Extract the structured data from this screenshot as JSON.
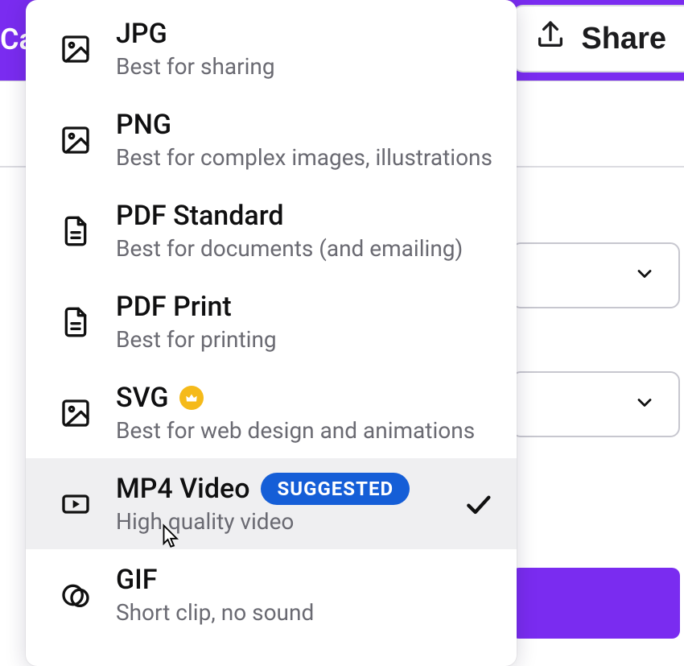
{
  "topbar": {
    "left_label_fragment": "Ca",
    "share_label": "Share"
  },
  "dropdown": {
    "selected_index": 5,
    "suggested_badge_text": "SUGGESTED",
    "options": [
      {
        "title": "JPG",
        "subtitle": "Best for sharing",
        "icon": "image"
      },
      {
        "title": "PNG",
        "subtitle": "Best for complex images, illustrations",
        "icon": "image"
      },
      {
        "title": "PDF Standard",
        "subtitle": "Best for documents (and emailing)",
        "icon": "pdf"
      },
      {
        "title": "PDF Print",
        "subtitle": "Best for printing",
        "icon": "pdf"
      },
      {
        "title": "SVG",
        "subtitle": "Best for web design and animations",
        "icon": "image",
        "premium": true
      },
      {
        "title": "MP4 Video",
        "subtitle": "High quality video",
        "icon": "video",
        "suggested": true,
        "selected": true
      },
      {
        "title": "GIF",
        "subtitle": "Short clip, no sound",
        "icon": "gif"
      }
    ]
  },
  "colors": {
    "brand_purple": "#7a2cf0",
    "badge_blue": "#155ed7",
    "premium_gold": "#f5ba1a"
  }
}
